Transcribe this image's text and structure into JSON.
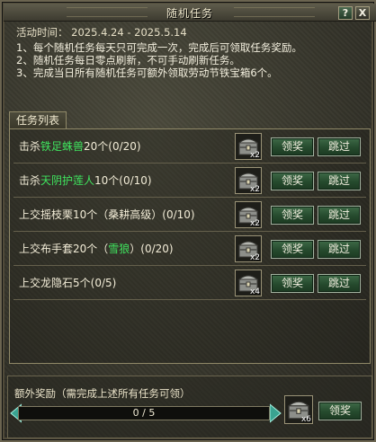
{
  "window": {
    "title": "随机任务",
    "help_label": "?",
    "close_label": "X"
  },
  "info": {
    "date_line": "活动时间： 2025.4.24 - 2025.5.14",
    "rules": [
      "1、每个随机任务每天只可完成一次，完成后可领取任务奖励。",
      "2、随机任务每日零点刷新，不可手动刷新任务。",
      "3、完成当日所有随机任务可额外领取劳动节铁宝箱6个。"
    ]
  },
  "tab": {
    "label": "任务列表"
  },
  "tasks": [
    {
      "prefix": "击杀",
      "highlight": "铁足蛛兽",
      "suffix": "20个(0/20)",
      "reward_qty": "x2",
      "claim": "领奖",
      "skip": "跳过"
    },
    {
      "prefix": "击杀",
      "highlight": "天阴护莲人",
      "suffix": "10个(0/10)",
      "reward_qty": "x2",
      "claim": "领奖",
      "skip": "跳过"
    },
    {
      "prefix": "上交摇枝栗10个（桑耕高级）(0/10)",
      "highlight": "",
      "suffix": "",
      "reward_qty": "x2",
      "claim": "领奖",
      "skip": "跳过"
    },
    {
      "prefix": "上交布手套20个（",
      "highlight": "雪狼",
      "suffix": "）(0/20)",
      "reward_qty": "x2",
      "claim": "领奖",
      "skip": "跳过"
    },
    {
      "prefix": "上交龙隐石5个(0/5)",
      "highlight": "",
      "suffix": "",
      "reward_qty": "x4",
      "claim": "领奖",
      "skip": "跳过"
    }
  ],
  "bonus": {
    "label": "额外奖励（需完成上述所有任务可领）",
    "progress_text": "0 / 5",
    "progress_fraction": 0,
    "reward_qty": "x6",
    "claim": "领奖"
  },
  "colors": {
    "highlight_green": "#3fe35e",
    "button_green": "#2f5a37",
    "frame": "#8f8867"
  },
  "icons": {
    "reward": "treasure-chest-icon"
  }
}
